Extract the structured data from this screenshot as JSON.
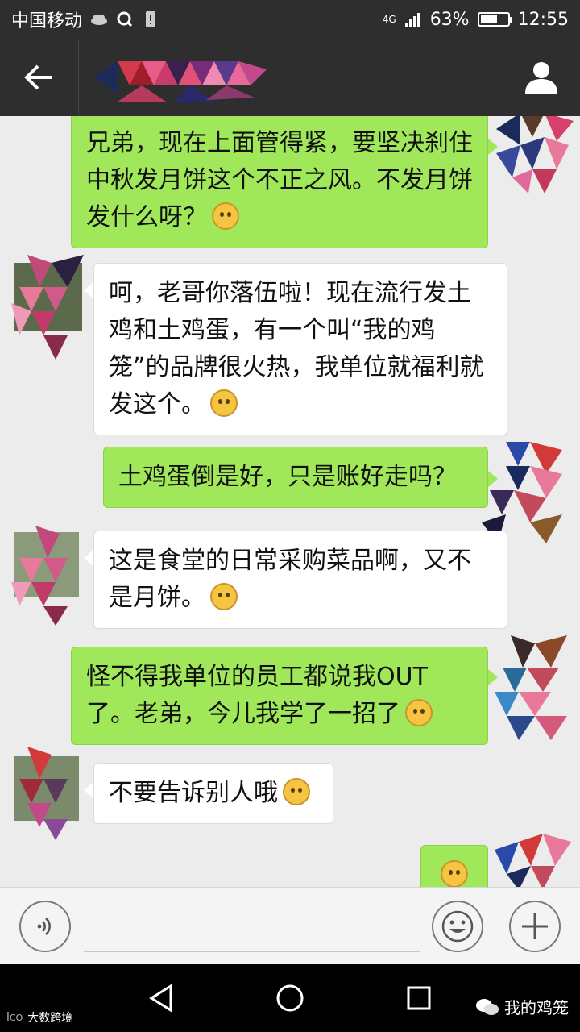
{
  "status_bar": {
    "carrier": "中国移动",
    "network": "4G",
    "battery_percent": "63%",
    "battery_level": 0.63,
    "time": "12:55"
  },
  "title_bar": {
    "back_icon": "arrow-left-icon",
    "contact_name_obscured": true,
    "profile_icon": "person-icon"
  },
  "messages": [
    {
      "sender": "me",
      "text": "兄弟，现在上面管得紧，要坚决刹住中秋发月饼这个不正之风。不发月饼发什么呀？",
      "emoji": "dizzy-emoji"
    },
    {
      "sender": "other",
      "text": "呵，老哥你落伍啦！现在流行发土鸡和土鸡蛋，有一个叫“我的鸡笼”的品牌很火热，我单位就福利就发这个。",
      "emoji": "sunglasses-emoji"
    },
    {
      "sender": "me",
      "text": "土鸡蛋倒是好，只是账好走吗？",
      "emoji": ""
    },
    {
      "sender": "other",
      "text": "这是食堂的日常采购菜品啊，又不是月饼。",
      "emoji": "shush-emoji"
    },
    {
      "sender": "me",
      "text": "怪不得我单位的员工都说我OUT了。老弟，今儿我学了一招了",
      "emoji": "grin-emoji"
    },
    {
      "sender": "other",
      "text": "不要告诉别人哦",
      "emoji": "thinking-emoji"
    },
    {
      "sender": "me",
      "text": "",
      "emoji": "ok-hand-emoji"
    }
  ],
  "input_bar": {
    "voice_icon": "voice-icon",
    "emoji_icon": "smiley-icon",
    "add_icon": "plus-icon",
    "input_value": ""
  },
  "nav_bar": {
    "back_icon": "triangle-back-icon",
    "home_icon": "circle-home-icon",
    "recent_icon": "square-recent-icon",
    "watermark_left": "大数跨境",
    "watermark_right": "我的鸡笼"
  },
  "colors": {
    "my_bubble": "#a0e75a",
    "their_bubble": "#ffffff",
    "chat_bg": "#ececec",
    "header_bg": "#2e2e2e"
  }
}
